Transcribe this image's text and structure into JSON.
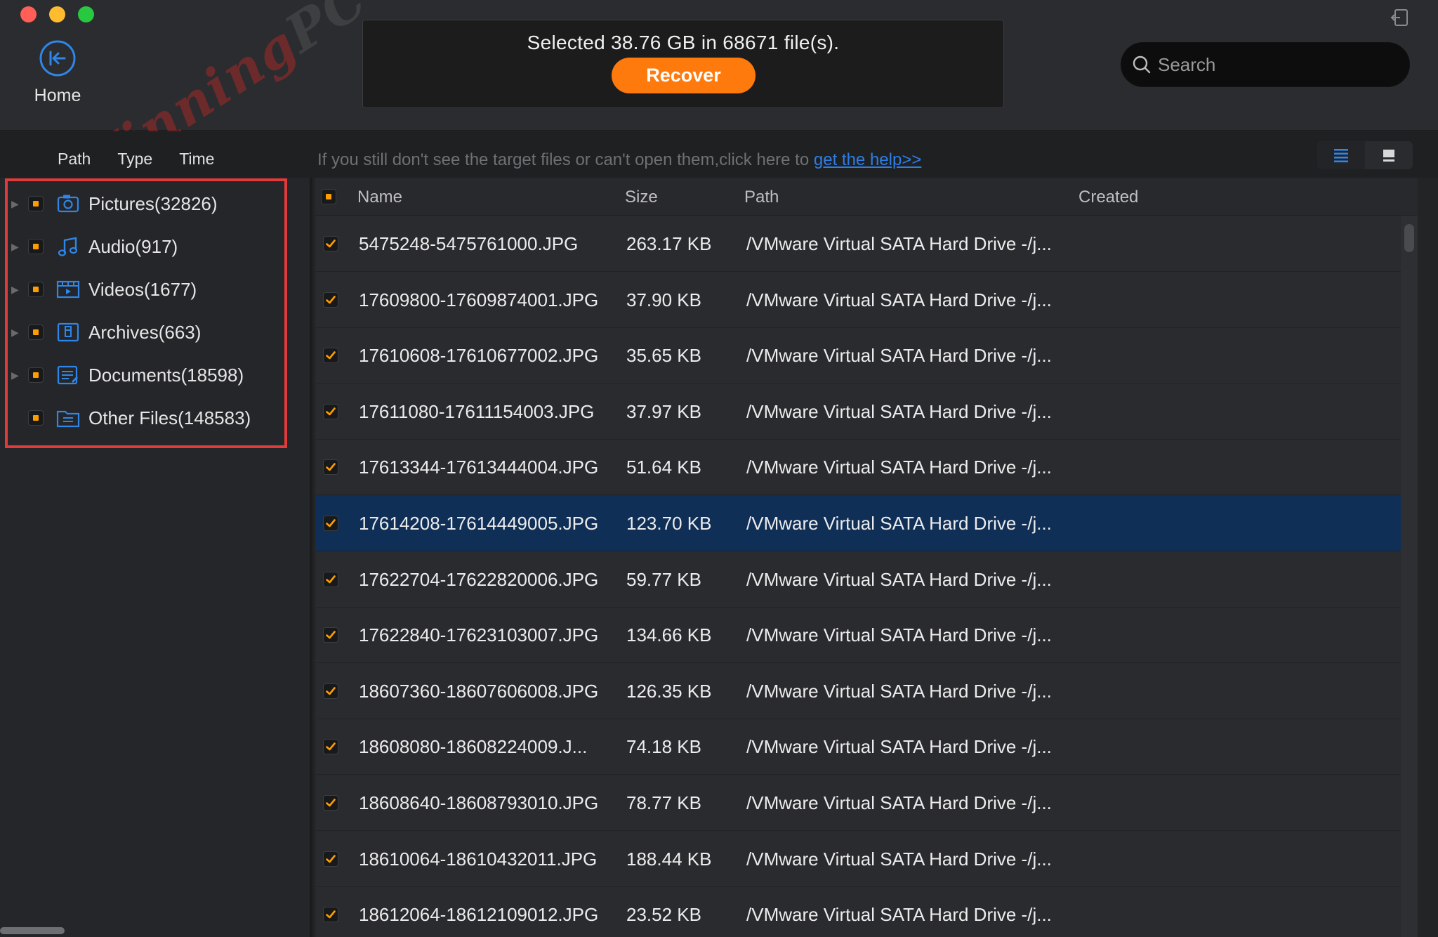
{
  "window": {
    "home_label": "Home",
    "watermark": {
      "part1": "Winning",
      "part2": "PC"
    }
  },
  "status": {
    "text": "Selected 38.76 GB in 68671 file(s).",
    "recover_label": "Recover"
  },
  "search": {
    "placeholder": "Search"
  },
  "sort_tabs": [
    "Path",
    "Type",
    "Time"
  ],
  "help": {
    "text": "If you still don't see the target files or can't open them,click here to ",
    "link": "get the help>>"
  },
  "categories": [
    {
      "label": "Pictures(32826)",
      "icon": "pictures-icon",
      "expandable": true
    },
    {
      "label": "Audio(917)",
      "icon": "audio-icon",
      "expandable": true
    },
    {
      "label": "Videos(1677)",
      "icon": "videos-icon",
      "expandable": true
    },
    {
      "label": "Archives(663)",
      "icon": "archives-icon",
      "expandable": true
    },
    {
      "label": "Documents(18598)",
      "icon": "documents-icon",
      "expandable": true
    },
    {
      "label": "Other Files(148583)",
      "icon": "other-files-icon",
      "expandable": false
    }
  ],
  "table": {
    "columns": {
      "name": "Name",
      "size": "Size",
      "path": "Path",
      "created": "Created"
    },
    "rows": [
      {
        "name": "5475248-5475761000.JPG",
        "size": "263.17 KB",
        "path": "/VMware Virtual SATA Hard Drive -/j..."
      },
      {
        "name": "17609800-17609874001.JPG",
        "size": "37.90 KB",
        "path": "/VMware Virtual SATA Hard Drive -/j..."
      },
      {
        "name": "17610608-17610677002.JPG",
        "size": "35.65 KB",
        "path": "/VMware Virtual SATA Hard Drive -/j..."
      },
      {
        "name": "17611080-17611154003.JPG",
        "size": "37.97 KB",
        "path": "/VMware Virtual SATA Hard Drive -/j..."
      },
      {
        "name": "17613344-17613444004.JPG",
        "size": "51.64 KB",
        "path": "/VMware Virtual SATA Hard Drive -/j..."
      },
      {
        "name": "17614208-17614449005.JPG",
        "size": "123.70 KB",
        "path": "/VMware Virtual SATA Hard Drive -/j...",
        "selected": true
      },
      {
        "name": "17622704-17622820006.JPG",
        "size": "59.77 KB",
        "path": "/VMware Virtual SATA Hard Drive -/j..."
      },
      {
        "name": "17622840-17623103007.JPG",
        "size": "134.66 KB",
        "path": "/VMware Virtual SATA Hard Drive -/j..."
      },
      {
        "name": "18607360-18607606008.JPG",
        "size": "126.35 KB",
        "path": "/VMware Virtual SATA Hard Drive -/j..."
      },
      {
        "name": "18608080-18608224009.J...",
        "size": "74.18 KB",
        "path": "/VMware Virtual SATA Hard Drive -/j..."
      },
      {
        "name": "18608640-18608793010.JPG",
        "size": "78.77 KB",
        "path": "/VMware Virtual SATA Hard Drive -/j..."
      },
      {
        "name": "18610064-18610432011.JPG",
        "size": "188.44 KB",
        "path": "/VMware Virtual SATA Hard Drive -/j..."
      },
      {
        "name": "18612064-18612109012.JPG",
        "size": "23.52 KB",
        "path": "/VMware Virtual SATA Hard Drive -/j..."
      }
    ]
  },
  "colors": {
    "accent": "#ff7a0c",
    "check": "#ff9d00",
    "link": "#2f7de1",
    "selected_row": "#0f2f57",
    "highlight_box": "#e03a3a",
    "icon_blue": "#2f86e8"
  }
}
